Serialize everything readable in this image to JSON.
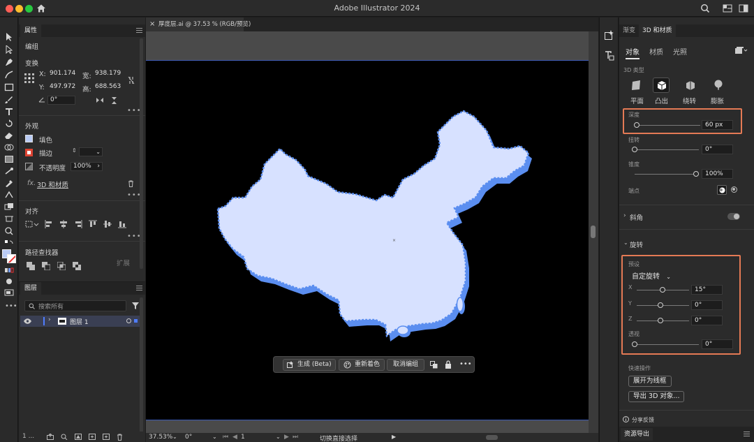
{
  "app": {
    "title": "Adobe Illustrator 2024"
  },
  "properties": {
    "tab": "属性",
    "object_type": "编组",
    "transform": {
      "title": "变换",
      "x_label": "X:",
      "x": "901.174",
      "y_label": "Y:",
      "y": "497.972",
      "w_label": "宽:",
      "w": "938.179",
      "h_label": "高:",
      "h": "688.563",
      "angle": "0°"
    },
    "appearance": {
      "title": "外观",
      "fill_label": "填色",
      "stroke_label": "描边",
      "opacity_label": "不透明度",
      "opacity": "100%",
      "effect_label": "3D 和材质",
      "fill_color": "#b9cbf5"
    },
    "align": {
      "title": "对齐"
    },
    "pathfinder": {
      "title": "路径查找器",
      "expand_label": "扩展"
    }
  },
  "layers": {
    "tab": "图层",
    "search_placeholder": "搜索所有",
    "rows": [
      {
        "name": "图层 1"
      }
    ],
    "footer_count": "1 ..."
  },
  "document": {
    "tab_title": "厚度层.ai @ 37.53 % (RGB/预览)",
    "map_fill": "#d7e1ff",
    "map_extrude": "#5b8ef0"
  },
  "context_bar": {
    "generate": "生成 (Beta)",
    "recolor": "重新着色",
    "ungroup": "取消编组"
  },
  "status": {
    "zoom": "37.53%",
    "rotation": "0°",
    "page": "1",
    "tool": "切换直接选择"
  },
  "panel3d": {
    "tab_gradient": "渐变",
    "tab_3d": "3D 和材质",
    "subtabs": [
      "对象",
      "材质",
      "光照"
    ],
    "type_title": "3D 类型",
    "types": [
      "平面",
      "凸出",
      "绕转",
      "膨胀"
    ],
    "depth_label": "深度",
    "depth": "60 px",
    "twist_label": "扭转",
    "twist": "0°",
    "taper_label": "锥度",
    "taper": "100%",
    "cap_label": "端点",
    "bevel_label": "斜角",
    "rotation_title": "旋转",
    "preset_label": "预设",
    "preset_value": "自定旋转",
    "x_label": "X",
    "x": "15°",
    "y_label": "Y",
    "y": "0°",
    "z_label": "Z",
    "z": "0°",
    "perspective_label": "透视",
    "perspective": "0°",
    "quick_actions_title": "快速操作",
    "expand_wireframe": "展开为线框",
    "export_3d": "导出 3D 对象...",
    "feedback": "分享反馈",
    "bottom_tab": "资源导出",
    "highlight_color": "#e57a55"
  }
}
